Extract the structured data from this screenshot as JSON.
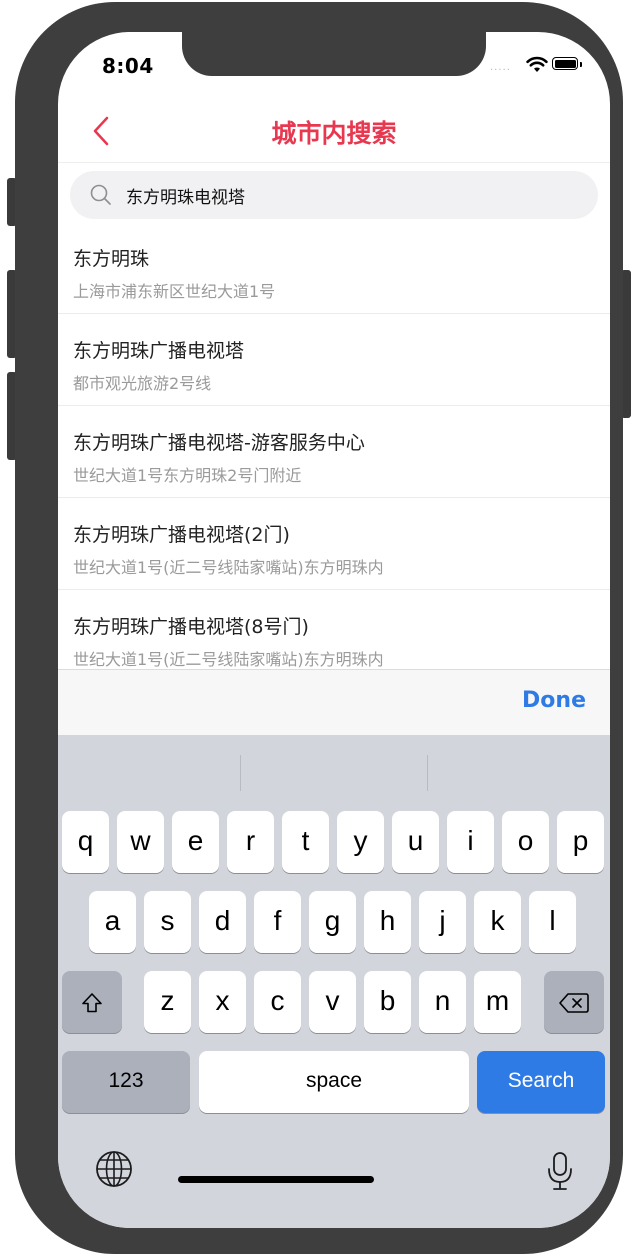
{
  "status_bar": {
    "time": "8:04",
    "signal_dots": "....."
  },
  "nav": {
    "title": "城市内搜索",
    "back_icon": "chevron-left-icon",
    "accent": "#e8384f"
  },
  "search": {
    "value": "东方明珠电视塔",
    "icon": "search-icon"
  },
  "results": [
    {
      "name": "东方明珠",
      "address": "上海市浦东新区世纪大道1号"
    },
    {
      "name": "东方明珠广播电视塔",
      "address": "都市观光旅游2号线"
    },
    {
      "name": "东方明珠广播电视塔-游客服务中心",
      "address": "世纪大道1号东方明珠2号门附近"
    },
    {
      "name": "东方明珠广播电视塔(2门)",
      "address": "世纪大道1号(近二号线陆家嘴站)东方明珠内"
    },
    {
      "name": "东方明珠广播电视塔(8号门)",
      "address": "世纪大道1号(近二号线陆家嘴站)东方明珠内"
    }
  ],
  "keyboard": {
    "done_label": "Done",
    "row1": [
      "q",
      "w",
      "e",
      "r",
      "t",
      "y",
      "u",
      "i",
      "o",
      "p"
    ],
    "row2": [
      "a",
      "s",
      "d",
      "f",
      "g",
      "h",
      "j",
      "k",
      "l"
    ],
    "row3": [
      "z",
      "x",
      "c",
      "v",
      "b",
      "n",
      "m"
    ],
    "numbers_label": "123",
    "space_label": "space",
    "search_label": "Search",
    "shift_symbol": "⇧",
    "accent": "#2f7be5"
  }
}
